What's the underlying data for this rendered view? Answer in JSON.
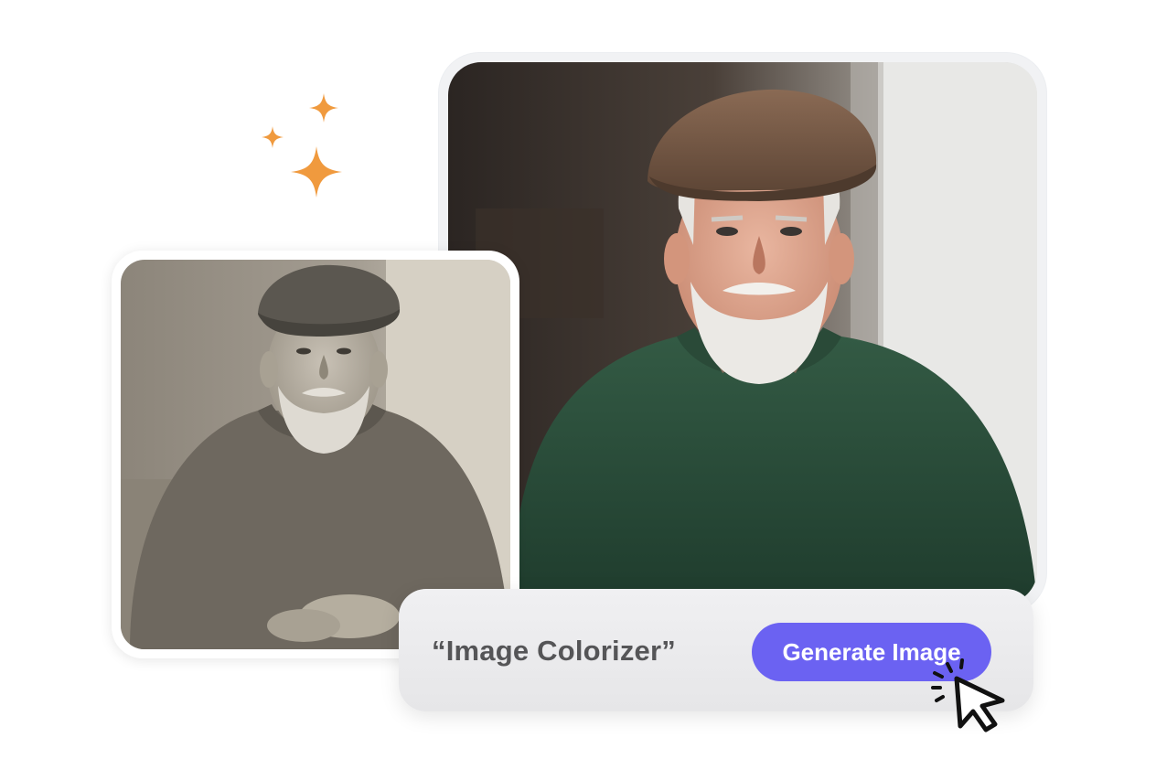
{
  "colors": {
    "accent": "#6b62f2",
    "sparkle": "#f09a3e",
    "prompt_text": "#555557",
    "button_text": "#ffffff"
  },
  "sparkles": [
    "sparkle-icon",
    "sparkle-icon",
    "sparkle-icon"
  ],
  "photos": {
    "original": "black-and-white portrait of elderly man in flat cap and knit sweater",
    "colorized": "color portrait of elderly man in brown flat cap and green knit sweater"
  },
  "prompt": {
    "text": "“Image Colorizer”",
    "button_label": "Generate Image"
  },
  "cursor": "pointer-click-icon"
}
